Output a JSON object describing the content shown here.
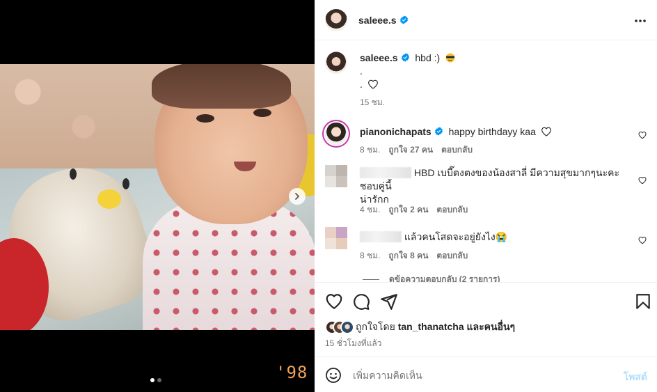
{
  "post": {
    "author": "saleee.s",
    "caption_text": "hbd :)",
    "caption_line2": ".",
    "caption_line3": ".",
    "caption_time": "15 ชม.",
    "year_stamp": "'98",
    "slides": 2,
    "active_slide": 1
  },
  "comments": [
    {
      "username": "pianonichapats",
      "text": "happy birthdayy kaa",
      "time": "8 ชม.",
      "likes": "ถูกใจ 27 คน",
      "reply": "ตอบกลับ"
    },
    {
      "username": "",
      "text": "HBD เบบี๊ตงตงของน้องสาลี่ มีความสุขมากๆนะคะ ชอบคู่นี้",
      "text2": "น่ารักก",
      "time": "4 ชม.",
      "likes": "ถูกใจ 2 คน",
      "reply": "ตอบกลับ"
    },
    {
      "username": "",
      "text": "แล้วคนโสดจะอยู่ยังไง😭",
      "time": "8 ชม.",
      "likes": "ถูกใจ 8 คน",
      "reply": "ตอบกลับ"
    }
  ],
  "view_replies": "ดูข้อความตอบกลับ (2 รายการ)",
  "liked_by": {
    "prefix": "ถูกใจโดย",
    "user": "tan_thanatcha",
    "suffix": "และคนอื่นๆ"
  },
  "time_ago": "15 ชั่วโมงที่แล้ว",
  "add_comment": {
    "placeholder": "เพิ่มความคิดเห็น",
    "post_label": "โพสต์"
  },
  "colors": {
    "verified": "#0095f6",
    "post_button": "#b2dffc",
    "secondary_text": "#737373",
    "year_stamp": "#f0a15a"
  },
  "icons": [
    "more-icon",
    "verified-icon",
    "heart-icon",
    "comment-icon",
    "share-icon",
    "bookmark-icon",
    "emoji-icon",
    "chevron-right-icon"
  ]
}
